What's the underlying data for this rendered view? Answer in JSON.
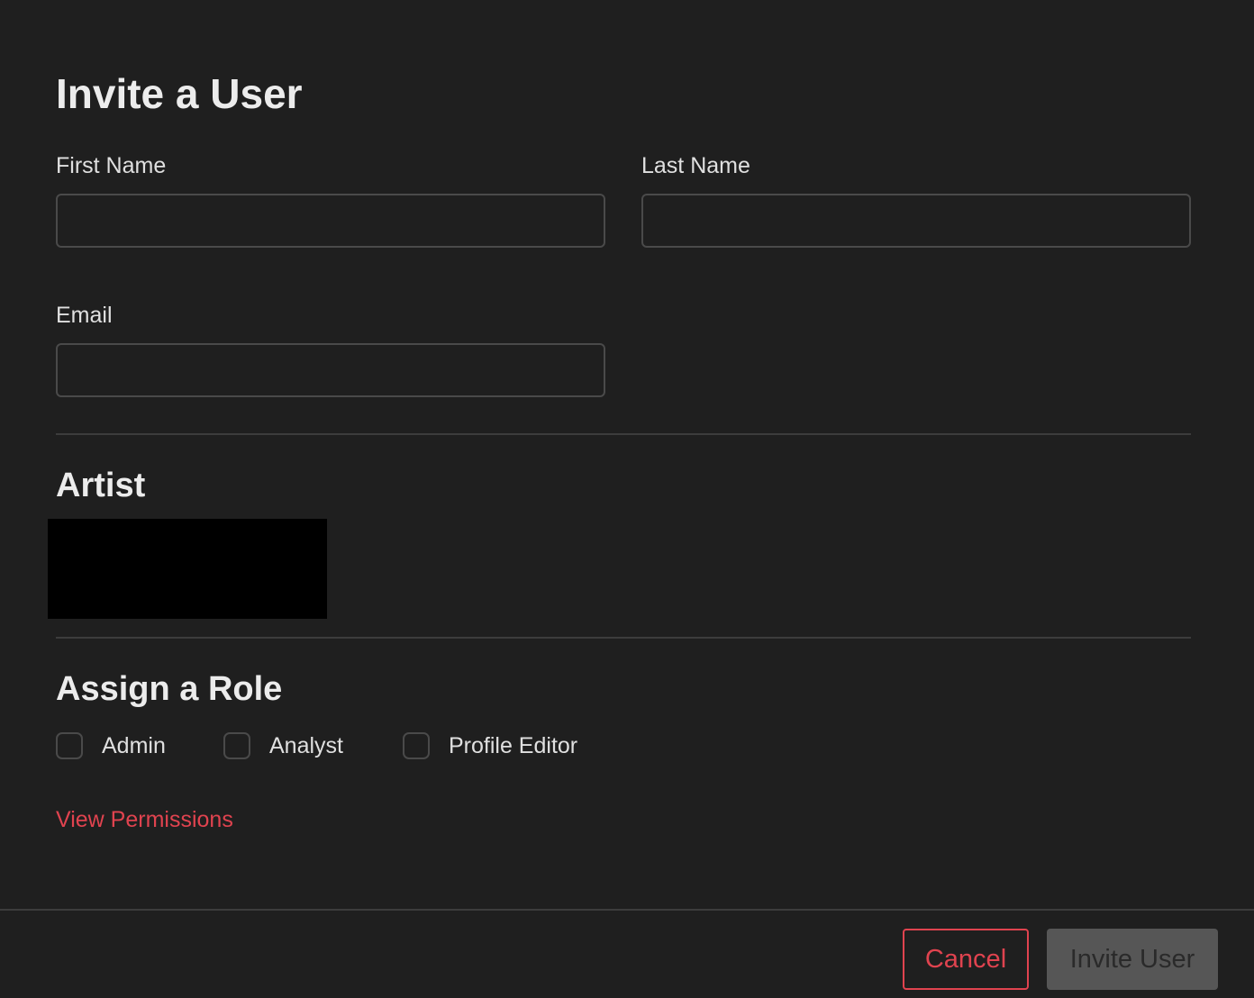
{
  "dialog": {
    "title": "Invite a User"
  },
  "form": {
    "first_name": {
      "label": "First Name",
      "value": "",
      "placeholder": ""
    },
    "last_name": {
      "label": "Last Name",
      "value": "",
      "placeholder": ""
    },
    "email": {
      "label": "Email",
      "value": "",
      "placeholder": ""
    }
  },
  "artist": {
    "heading": "Artist"
  },
  "roles": {
    "heading": "Assign a Role",
    "options": [
      {
        "label": "Admin",
        "checked": false
      },
      {
        "label": "Analyst",
        "checked": false
      },
      {
        "label": "Profile Editor",
        "checked": false
      }
    ],
    "view_permissions_link": "View Permissions"
  },
  "footer": {
    "cancel_label": "Cancel",
    "invite_label": "Invite User"
  },
  "colors": {
    "background": "#1f1f1f",
    "accent": "#e0434f",
    "disabled_button": "#565656",
    "border": "#4a4a4a"
  }
}
